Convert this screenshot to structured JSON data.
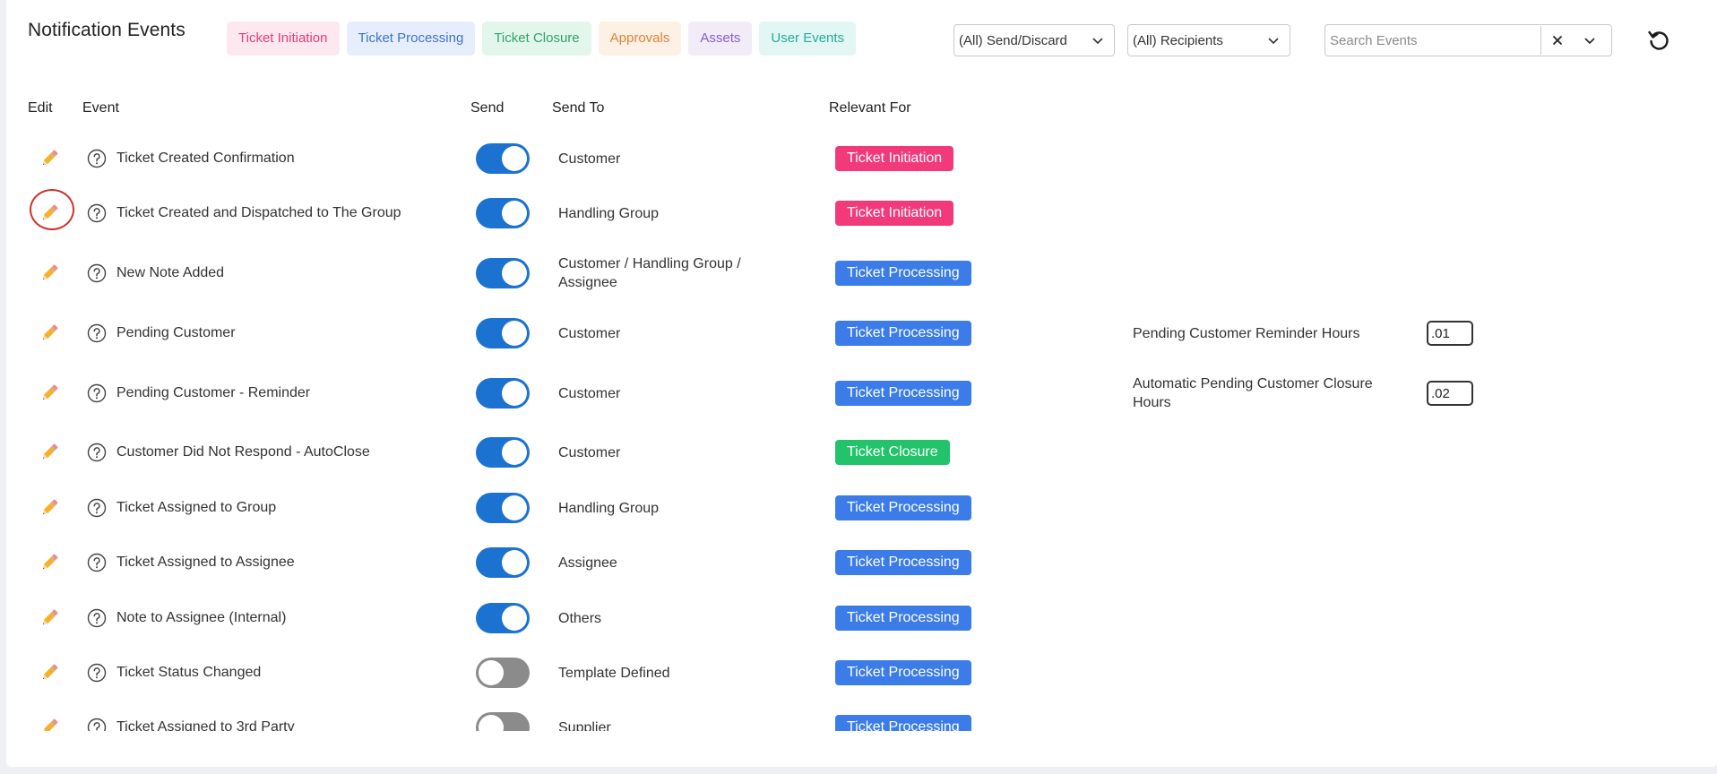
{
  "title": "Notification Events",
  "chips": [
    {
      "label": "Ticket Initiation",
      "bg": "#fde8ef",
      "fg": "#e63c75"
    },
    {
      "label": "Ticket Processing",
      "bg": "#e6eefb",
      "fg": "#3f74c9"
    },
    {
      "label": "Ticket Closure",
      "bg": "#e3f6ec",
      "fg": "#2ea46a"
    },
    {
      "label": "Approvals",
      "bg": "#fdf0e4",
      "fg": "#e0823a"
    },
    {
      "label": "Assets",
      "bg": "#f1ecf8",
      "fg": "#8c5bc7"
    },
    {
      "label": "User Events",
      "bg": "#e2f6f4",
      "fg": "#26a99a"
    }
  ],
  "filters": {
    "send_discard": "(All) Send/Discard",
    "recipients": "(All) Recipients",
    "search_placeholder": "Search Events"
  },
  "columns": {
    "edit": "Edit",
    "event": "Event",
    "send": "Send",
    "send_to": "Send To",
    "relevant_for": "Relevant For"
  },
  "badge_colors": {
    "Ticket Initiation": "#f23a7a",
    "Ticket Processing": "#3b7ce8",
    "Ticket Closure": "#22c36b"
  },
  "icons": {
    "edit": "pencil-icon",
    "help": "question-circle-icon",
    "clear": "close-icon",
    "expand": "chevron-down-icon",
    "refresh": "refresh-icon"
  },
  "rows": [
    {
      "event": "Ticket Created Confirmation",
      "send": true,
      "send_to": "Customer",
      "relevant": "Ticket Initiation"
    },
    {
      "event": "Ticket Created and Dispatched to The Group",
      "send": true,
      "send_to": "Handling Group",
      "relevant": "Ticket Initiation"
    },
    {
      "event": "New Note Added",
      "send": true,
      "send_to": "Customer / Handling Group / Assignee",
      "relevant": "Ticket Processing"
    },
    {
      "event": "Pending Customer",
      "send": true,
      "send_to": "Customer",
      "relevant": "Ticket Processing",
      "param_label": "Pending Customer Reminder Hours",
      "param_value": ".01"
    },
    {
      "event": "Pending Customer - Reminder",
      "send": true,
      "send_to": "Customer",
      "relevant": "Ticket Processing",
      "param_label": "Automatic Pending Customer Closure Hours",
      "param_value": ".02"
    },
    {
      "event": "Customer Did Not Respond - AutoClose",
      "send": true,
      "send_to": "Customer",
      "relevant": "Ticket Closure"
    },
    {
      "event": "Ticket Assigned to Group",
      "send": true,
      "send_to": "Handling Group",
      "relevant": "Ticket Processing"
    },
    {
      "event": "Ticket Assigned to Assignee",
      "send": true,
      "send_to": "Assignee",
      "relevant": "Ticket Processing"
    },
    {
      "event": "Note to Assignee (Internal)",
      "send": true,
      "send_to": "Others",
      "relevant": "Ticket Processing"
    },
    {
      "event": "Ticket Status Changed",
      "send": false,
      "send_to": "Template Defined",
      "relevant": "Ticket Processing"
    },
    {
      "event": "Ticket Assigned to 3rd Party",
      "send": false,
      "send_to": "Supplier",
      "relevant": "Ticket Processing"
    }
  ]
}
